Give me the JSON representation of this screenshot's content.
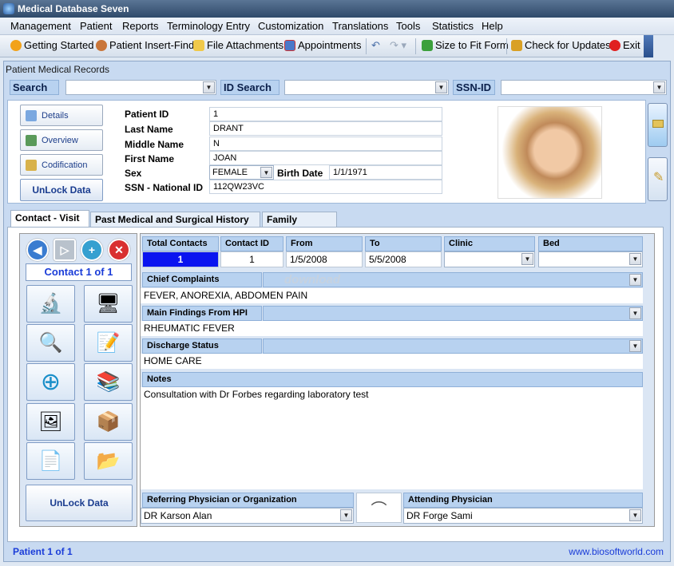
{
  "window": {
    "title": "Medical Database Seven"
  },
  "menu": [
    "Management",
    "Patient",
    "Reports",
    "Terminology Entry",
    "Customization",
    "Translations",
    "Tools",
    "Statistics",
    "Help"
  ],
  "toolbar": {
    "getting_started": "Getting Started",
    "patient_insert_find": "Patient Insert-Find",
    "file_attachments": "File Attachments",
    "appointments": "Appointments",
    "size_to_fit": "Size to Fit Form",
    "check_updates": "Check for Updates",
    "exit": "Exit"
  },
  "panel_title": "Patient Medical Records",
  "search": {
    "search_label": "Search",
    "id_search_label": "ID Search",
    "ssn_label": "SSN-ID"
  },
  "side_buttons": {
    "details": "Details",
    "overview": "Overview",
    "codification": "Codification",
    "unlock": "UnLock Data"
  },
  "patient": {
    "labels": {
      "id": "Patient ID",
      "last": "Last Name",
      "middle": "Middle Name",
      "first": "First Name",
      "sex": "Sex",
      "birth": "Birth Date",
      "ssn": "SSN - National ID"
    },
    "id": "1",
    "last_name": "DRANT",
    "middle_name": "N",
    "first_name": "JOAN",
    "sex": "FEMALE",
    "birth_date": "1/1/1971",
    "ssn": "112QW23VC"
  },
  "tabs": [
    "Contact - Visit",
    "Past Medical and Surgical History",
    "Family History"
  ],
  "contact_nav": {
    "label": "Contact 1 of 1",
    "unlock": "UnLock Data"
  },
  "contact": {
    "headers": {
      "total": "Total Contacts",
      "contact_id": "Contact ID",
      "from": "From",
      "to": "To",
      "clinic": "Clinic",
      "bed": "Bed"
    },
    "total": "1",
    "contact_id": "1",
    "from": "1/5/2008",
    "to": "5/5/2008",
    "clinic": "",
    "bed": ""
  },
  "chief_complaints": {
    "label": "Chief Complaints",
    "value": "FEVER, ANOREXIA, ABDOMEN PAIN"
  },
  "main_findings": {
    "label": "Main Findings From HPI",
    "value": "RHEUMATIC FEVER"
  },
  "discharge": {
    "label": "Discharge Status",
    "value": "HOME CARE"
  },
  "notes": {
    "label": "Notes",
    "value": "Consultation with Dr Forbes regarding laboratory test"
  },
  "referring": {
    "label": "Referring Physician or Organization",
    "value": "DR Karson Alan"
  },
  "attending": {
    "label": "Attending Physician",
    "value": "DR Forge Sami"
  },
  "watermark": "download",
  "status": {
    "left": "Patient 1 of 1",
    "right": "www.biosoftworld.com"
  },
  "colors": {
    "accent": "#1a3c8f",
    "header_bg": "#b8d2f0",
    "selected_cell": "#0000ff"
  }
}
